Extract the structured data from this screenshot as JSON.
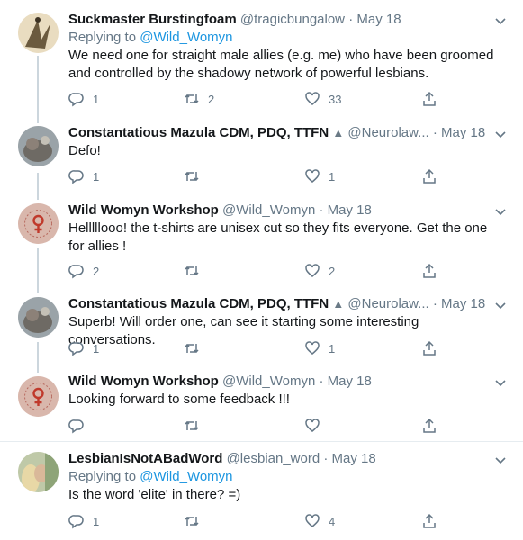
{
  "tweets": [
    {
      "name": "Suckmaster Burstingfoam",
      "handle": "@tragicbungalow",
      "date": "May 18",
      "replying_prefix": "Replying to ",
      "replying_to": "@Wild_Womyn",
      "text": "We need one for straight male allies (e.g. me) who have been groomed and controlled by the shadowy network of powerful lesbians.",
      "replies": "1",
      "retweets": "2",
      "likes": "33"
    },
    {
      "name": "Constantatious Mazula CDM, PDQ, TTFN",
      "handle": "@Neurolaw...",
      "date": "May 18",
      "text": "Defo!",
      "replies": "1",
      "retweets": "",
      "likes": "1"
    },
    {
      "name": "Wild Womyn Workshop",
      "handle": "@Wild_Womyn",
      "date": "May 18",
      "text": "Helllllooo! the t-shirts are unisex cut so they fits everyone. Get the one for allies !",
      "replies": "2",
      "retweets": "",
      "likes": "2"
    },
    {
      "name": "Constantatious Mazula CDM, PDQ, TTFN",
      "handle": "@Neurolaw...",
      "date": "May 18",
      "text": "Superb! Will order one, can see it starting some interesting conversations.",
      "replies": "1",
      "retweets": "",
      "likes": "1"
    },
    {
      "name": "Wild Womyn Workshop",
      "handle": "@Wild_Womyn",
      "date": "May 18",
      "text": "Looking forward to some feedback !!!",
      "replies": "",
      "retweets": "",
      "likes": ""
    },
    {
      "name": "LesbianIsNotABadWord",
      "handle": "@lesbian_word",
      "date": "May 18",
      "replying_prefix": "Replying to ",
      "replying_to": "@Wild_Womyn",
      "text": "Is the word 'elite' in there? =)",
      "replies": "1",
      "retweets": "",
      "likes": "4"
    }
  ],
  "separator": "·",
  "colors": {
    "text": "#14171a",
    "muted": "#657786",
    "link": "#1b95e0",
    "line": "#ccd6dd",
    "divider": "#e6ecf0"
  }
}
